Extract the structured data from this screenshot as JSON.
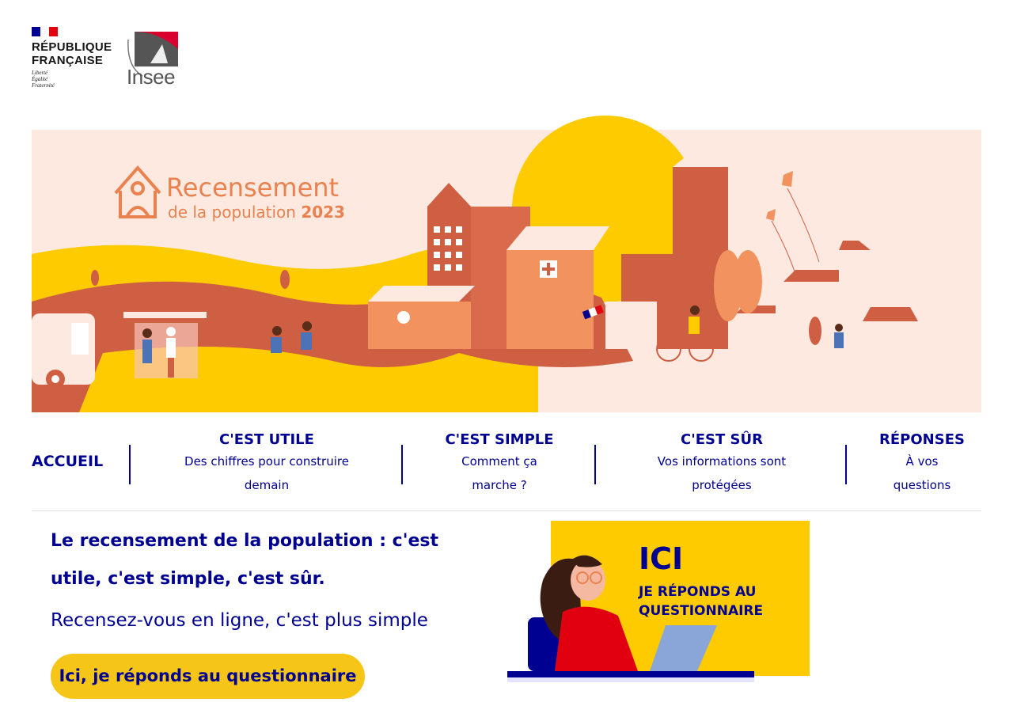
{
  "header": {
    "republic_line1": "RÉPUBLIQUE",
    "republic_line2": "FRANÇAISE",
    "motto_1": "Liberté",
    "motto_2": "Égalité",
    "motto_3": "Fraternité",
    "insee": "Insee"
  },
  "banner": {
    "title": "Recensement",
    "subtitle_prefix": "de la population",
    "subtitle_year": "2023"
  },
  "nav": {
    "home": "ACCUEIL",
    "items": [
      {
        "title": "C'EST UTILE",
        "subtitle": "Des chiffres pour construire demain"
      },
      {
        "title": "C'EST SIMPLE",
        "subtitle": "Comment ça marche ?"
      },
      {
        "title": "C'EST SÛR",
        "subtitle": "Vos informations sont protégées"
      },
      {
        "title": "RÉPONSES",
        "subtitle": "À vos questions"
      }
    ]
  },
  "main": {
    "lead": "Le recensement de la population : c'est utile, c'est simple, c'est sûr.",
    "sub": "Recensez-vous en ligne, c'est plus simple",
    "cta": "Ici, je réponds au questionnaire"
  },
  "promo": {
    "ici": "ICI",
    "line1": "JE RÉPONDS AU",
    "line2": "QUESTIONNAIRE"
  },
  "colors": {
    "primary": "#000091",
    "accent_yellow": "#f5c518",
    "banner_bg": "#fde9e0",
    "terracotta": "#cf5f43",
    "orange": "#e9824f"
  }
}
